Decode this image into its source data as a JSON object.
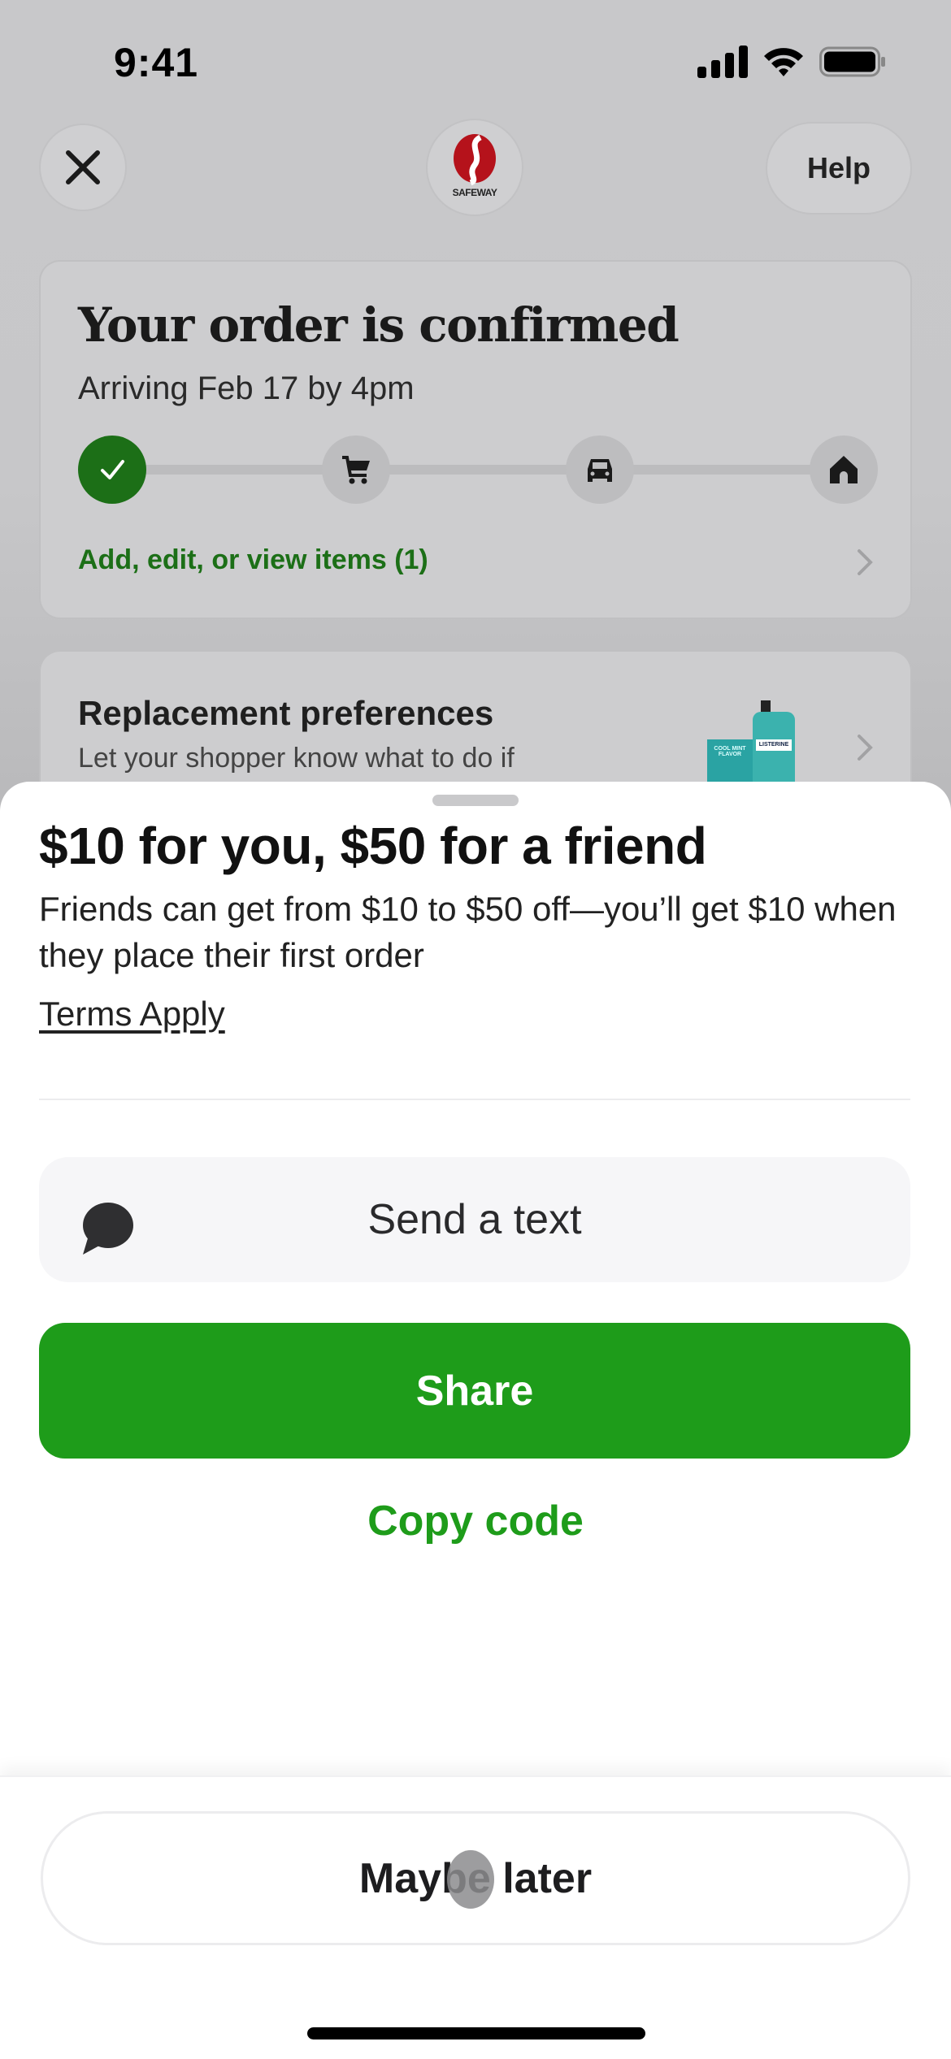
{
  "status_bar": {
    "time": "9:41",
    "icons": [
      "cellular-signal-icon",
      "wifi-icon",
      "battery-icon"
    ]
  },
  "header": {
    "close_icon": "close-icon",
    "logo_text": "SAFEWAY",
    "help_label": "Help"
  },
  "order_card": {
    "title": "Your order is confirmed",
    "subtitle": "Arriving Feb 17 by 4pm",
    "steps": [
      {
        "name": "confirmed",
        "icon": "check-icon",
        "done": true
      },
      {
        "name": "shopping",
        "icon": "cart-icon",
        "done": false
      },
      {
        "name": "delivering",
        "icon": "car-icon",
        "done": false
      },
      {
        "name": "delivered",
        "icon": "home-icon",
        "done": false
      }
    ],
    "link_label": "Add, edit, or view items (1)"
  },
  "replacement_card": {
    "title": "Replacement preferences",
    "subtitle": "Let your shopper know what to do if",
    "product_labels": {
      "box": "COOL MINT FLAVOR",
      "bottle": "LISTERINE"
    }
  },
  "sheet": {
    "title": "$10 for you, $50 for a friend",
    "body": "Friends can get from $10 to $50 off—you’ll get $10 when they place their first order",
    "terms_label": "Terms Apply",
    "send_text_label": "Send a text",
    "share_label": "Share",
    "copy_code_label": "Copy code",
    "maybe_later_label": "Maybe later"
  },
  "colors": {
    "brand_green": "#1e9c1a",
    "dark_green": "#1c6f17",
    "safeway_red": "#b5121b"
  }
}
